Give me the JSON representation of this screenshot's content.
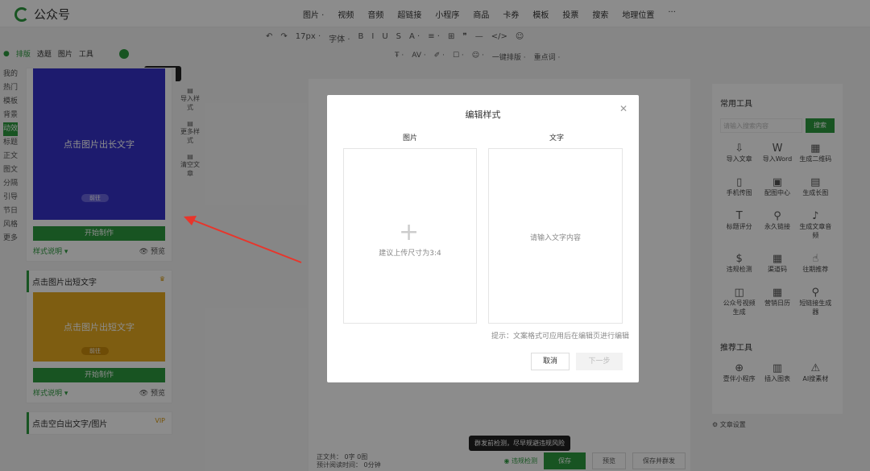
{
  "app": {
    "title": "公众号"
  },
  "topnav": [
    "图片 ·",
    "视频",
    "音频",
    "超链接",
    "小程序",
    "商品",
    "卡券",
    "模板",
    "投票",
    "搜索",
    "地理位置",
    "···"
  ],
  "toolbar1": [
    "↶",
    "↷",
    "17px ·",
    "字体 ·",
    "B",
    "I",
    "U",
    "S",
    "A ·",
    "≡ ·",
    "⊞",
    "❞",
    "—",
    "</>",
    "☺"
  ],
  "toolbar2": [
    "Ŧ ·",
    "AV ·",
    "✐ ·",
    "☐ ·",
    "☺ ·",
    "一键排版 ·",
    "重点词 ·"
  ],
  "left_tabs": {
    "layout": "排版",
    "topic": "选题",
    "image": "图片",
    "tools": "工具"
  },
  "left_tooltip": "点击收起",
  "left_rail": [
    "我的",
    "热门",
    "模板",
    "背景",
    "动效",
    "标题",
    "正文",
    "图文",
    "分隔",
    "引导",
    "节日",
    "风格",
    "更多"
  ],
  "template_cards": [
    {
      "title": "点击图片出长文字",
      "thumb_text": "点击图片出长文字",
      "mini": "前往",
      "start": "开始制作",
      "desc": "样式说明 ▾",
      "preview": "预览",
      "color": "#3532c8"
    },
    {
      "title": "点击图片出短文字",
      "thumb_text": "点击图片出短文字",
      "mini": "前往",
      "start": "开始制作",
      "desc": "样式说明 ▾",
      "preview": "预览",
      "color": "#e6a91f"
    },
    {
      "title": "点击空白出文字/图片",
      "vip": "VIP"
    }
  ],
  "mid_actions": [
    "导入样式",
    "更多样式",
    "清空文章"
  ],
  "right_panel": {
    "title": "常用工具",
    "search_placeholder": "请输入搜索内容",
    "search_btn": "搜索",
    "tools": [
      {
        "icon": "⇩",
        "label": "导入文章"
      },
      {
        "icon": "W",
        "label": "导入Word"
      },
      {
        "icon": "▦",
        "label": "生成二维码"
      },
      {
        "icon": "▯",
        "label": "手机传图"
      },
      {
        "icon": "▣",
        "label": "配图中心"
      },
      {
        "icon": "▤",
        "label": "生成长图"
      },
      {
        "icon": "T",
        "label": "标题评分"
      },
      {
        "icon": "⚲",
        "label": "永久链接"
      },
      {
        "icon": "♪",
        "label": "生成文章音频"
      },
      {
        "icon": "$",
        "label": "违规检测"
      },
      {
        "icon": "▦",
        "label": "渠道码"
      },
      {
        "icon": "☝",
        "label": "往期推荐"
      },
      {
        "icon": "◫",
        "label": "公众号视频生成"
      },
      {
        "icon": "▦",
        "label": "营销日历"
      },
      {
        "icon": "⚲",
        "label": "短链接生成器"
      }
    ],
    "recommend_title": "推荐工具",
    "recommend": [
      {
        "icon": "⊕",
        "label": "壹伴小程序"
      },
      {
        "icon": "▥",
        "label": "插入图表"
      },
      {
        "icon": "⚠",
        "label": "AI搜素材"
      }
    ],
    "article_settings": "文章设置"
  },
  "modal": {
    "title": "编辑样式",
    "col_image": "图片",
    "col_text": "文字",
    "image_hint": "建议上传尺寸为3:4",
    "text_placeholder": "请输入文字内容",
    "tip": "提示：文案格式可应用后在编辑页进行编辑",
    "cancel": "取消",
    "next": "下一步"
  },
  "bottom": {
    "word_count": "正文共： 0字 0图",
    "read_time": "预计阅读时间： 0分钟",
    "check": "违规检测",
    "save": "保存",
    "preview": "预览",
    "save_send": "保存并群发",
    "tooltip": "群发前检测，尽早规避违规风险"
  },
  "colors": {
    "brand": "#2c9a3e",
    "arrow": "#e8352b"
  }
}
